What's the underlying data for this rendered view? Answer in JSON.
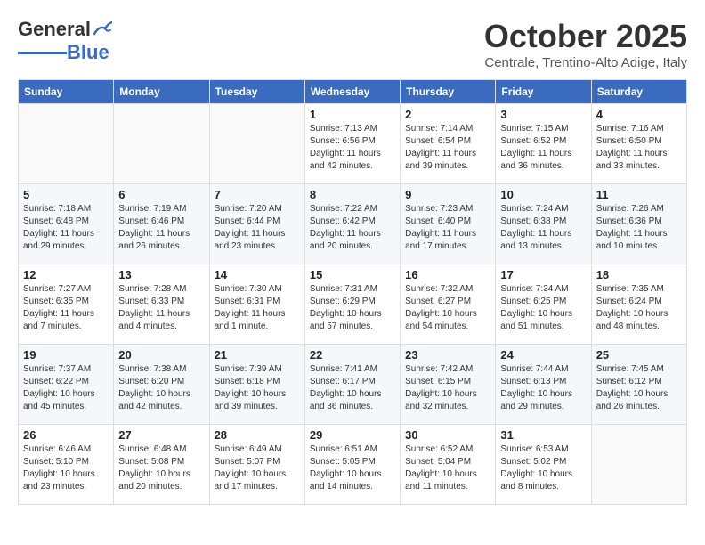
{
  "header": {
    "logo_general": "General",
    "logo_blue": "Blue",
    "month_title": "October 2025",
    "location": "Centrale, Trentino-Alto Adige, Italy"
  },
  "days_of_week": [
    "Sunday",
    "Monday",
    "Tuesday",
    "Wednesday",
    "Thursday",
    "Friday",
    "Saturday"
  ],
  "weeks": [
    [
      {
        "day": "",
        "info": ""
      },
      {
        "day": "",
        "info": ""
      },
      {
        "day": "",
        "info": ""
      },
      {
        "day": "1",
        "info": "Sunrise: 7:13 AM\nSunset: 6:56 PM\nDaylight: 11 hours and 42 minutes."
      },
      {
        "day": "2",
        "info": "Sunrise: 7:14 AM\nSunset: 6:54 PM\nDaylight: 11 hours and 39 minutes."
      },
      {
        "day": "3",
        "info": "Sunrise: 7:15 AM\nSunset: 6:52 PM\nDaylight: 11 hours and 36 minutes."
      },
      {
        "day": "4",
        "info": "Sunrise: 7:16 AM\nSunset: 6:50 PM\nDaylight: 11 hours and 33 minutes."
      }
    ],
    [
      {
        "day": "5",
        "info": "Sunrise: 7:18 AM\nSunset: 6:48 PM\nDaylight: 11 hours and 29 minutes."
      },
      {
        "day": "6",
        "info": "Sunrise: 7:19 AM\nSunset: 6:46 PM\nDaylight: 11 hours and 26 minutes."
      },
      {
        "day": "7",
        "info": "Sunrise: 7:20 AM\nSunset: 6:44 PM\nDaylight: 11 hours and 23 minutes."
      },
      {
        "day": "8",
        "info": "Sunrise: 7:22 AM\nSunset: 6:42 PM\nDaylight: 11 hours and 20 minutes."
      },
      {
        "day": "9",
        "info": "Sunrise: 7:23 AM\nSunset: 6:40 PM\nDaylight: 11 hours and 17 minutes."
      },
      {
        "day": "10",
        "info": "Sunrise: 7:24 AM\nSunset: 6:38 PM\nDaylight: 11 hours and 13 minutes."
      },
      {
        "day": "11",
        "info": "Sunrise: 7:26 AM\nSunset: 6:36 PM\nDaylight: 11 hours and 10 minutes."
      }
    ],
    [
      {
        "day": "12",
        "info": "Sunrise: 7:27 AM\nSunset: 6:35 PM\nDaylight: 11 hours and 7 minutes."
      },
      {
        "day": "13",
        "info": "Sunrise: 7:28 AM\nSunset: 6:33 PM\nDaylight: 11 hours and 4 minutes."
      },
      {
        "day": "14",
        "info": "Sunrise: 7:30 AM\nSunset: 6:31 PM\nDaylight: 11 hours and 1 minute."
      },
      {
        "day": "15",
        "info": "Sunrise: 7:31 AM\nSunset: 6:29 PM\nDaylight: 10 hours and 57 minutes."
      },
      {
        "day": "16",
        "info": "Sunrise: 7:32 AM\nSunset: 6:27 PM\nDaylight: 10 hours and 54 minutes."
      },
      {
        "day": "17",
        "info": "Sunrise: 7:34 AM\nSunset: 6:25 PM\nDaylight: 10 hours and 51 minutes."
      },
      {
        "day": "18",
        "info": "Sunrise: 7:35 AM\nSunset: 6:24 PM\nDaylight: 10 hours and 48 minutes."
      }
    ],
    [
      {
        "day": "19",
        "info": "Sunrise: 7:37 AM\nSunset: 6:22 PM\nDaylight: 10 hours and 45 minutes."
      },
      {
        "day": "20",
        "info": "Sunrise: 7:38 AM\nSunset: 6:20 PM\nDaylight: 10 hours and 42 minutes."
      },
      {
        "day": "21",
        "info": "Sunrise: 7:39 AM\nSunset: 6:18 PM\nDaylight: 10 hours and 39 minutes."
      },
      {
        "day": "22",
        "info": "Sunrise: 7:41 AM\nSunset: 6:17 PM\nDaylight: 10 hours and 36 minutes."
      },
      {
        "day": "23",
        "info": "Sunrise: 7:42 AM\nSunset: 6:15 PM\nDaylight: 10 hours and 32 minutes."
      },
      {
        "day": "24",
        "info": "Sunrise: 7:44 AM\nSunset: 6:13 PM\nDaylight: 10 hours and 29 minutes."
      },
      {
        "day": "25",
        "info": "Sunrise: 7:45 AM\nSunset: 6:12 PM\nDaylight: 10 hours and 26 minutes."
      }
    ],
    [
      {
        "day": "26",
        "info": "Sunrise: 6:46 AM\nSunset: 5:10 PM\nDaylight: 10 hours and 23 minutes."
      },
      {
        "day": "27",
        "info": "Sunrise: 6:48 AM\nSunset: 5:08 PM\nDaylight: 10 hours and 20 minutes."
      },
      {
        "day": "28",
        "info": "Sunrise: 6:49 AM\nSunset: 5:07 PM\nDaylight: 10 hours and 17 minutes."
      },
      {
        "day": "29",
        "info": "Sunrise: 6:51 AM\nSunset: 5:05 PM\nDaylight: 10 hours and 14 minutes."
      },
      {
        "day": "30",
        "info": "Sunrise: 6:52 AM\nSunset: 5:04 PM\nDaylight: 10 hours and 11 minutes."
      },
      {
        "day": "31",
        "info": "Sunrise: 6:53 AM\nSunset: 5:02 PM\nDaylight: 10 hours and 8 minutes."
      },
      {
        "day": "",
        "info": ""
      }
    ]
  ]
}
